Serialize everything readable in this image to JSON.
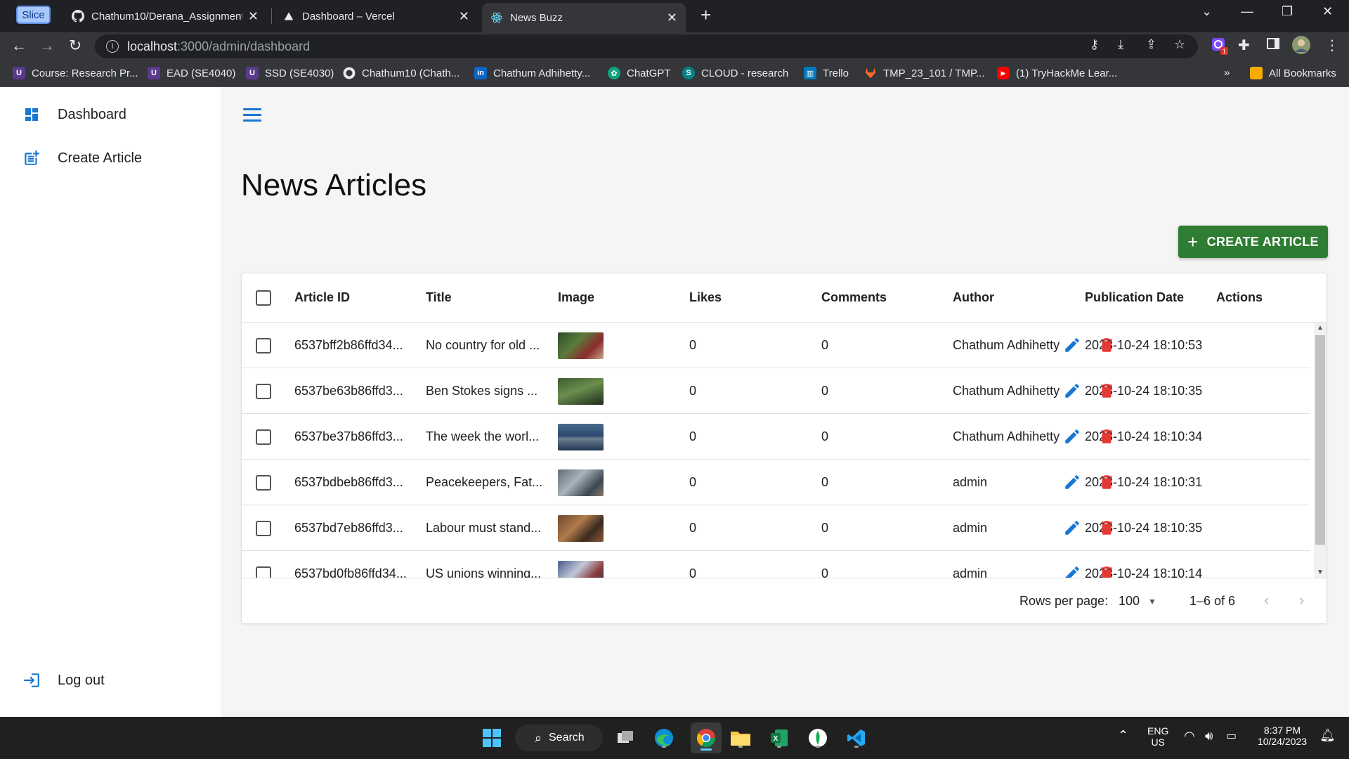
{
  "browser": {
    "slice_label": "Slice",
    "tabs": [
      {
        "title": "Chathum10/Derana_Assignment",
        "icon": "github-icon"
      },
      {
        "title": "Dashboard – Vercel",
        "icon": "vercel-icon"
      },
      {
        "title": "News Buzz",
        "icon": "react-icon",
        "active": true
      }
    ],
    "url_host": "localhost",
    "url_path": ":3000/admin/dashboard",
    "bookmarks": [
      {
        "label": "Course: Research Pr...",
        "icon": "university-icon"
      },
      {
        "label": "EAD (SE4040)",
        "icon": "university-icon"
      },
      {
        "label": "SSD (SE4030)",
        "icon": "university-icon"
      },
      {
        "label": "Chathum10 (Chath...",
        "icon": "github-icon"
      },
      {
        "label": "Chathum Adhihetty...",
        "icon": "linkedin-icon"
      },
      {
        "label": "ChatGPT",
        "icon": "chatgpt-icon"
      },
      {
        "label": "CLOUD - research",
        "icon": "sharepoint-icon"
      },
      {
        "label": "Trello",
        "icon": "trello-icon"
      },
      {
        "label": "TMP_23_101 / TMP...",
        "icon": "gitlab-icon"
      },
      {
        "label": "(1) TryHackMe Lear...",
        "icon": "youtube-icon"
      }
    ],
    "bookmarks_overflow": "»",
    "all_bookmarks": "All Bookmarks"
  },
  "sidebar": {
    "items": [
      {
        "label": "Dashboard",
        "icon": "dashboard-icon"
      },
      {
        "label": "Create Article",
        "icon": "post-add-icon"
      }
    ],
    "logout_label": "Log out"
  },
  "main": {
    "title": "News Articles",
    "create_button": "CREATE ARTICLE"
  },
  "table": {
    "columns": [
      "Article ID",
      "Title",
      "Image",
      "Likes",
      "Comments",
      "Author",
      "Publication Date",
      "Actions"
    ],
    "rows": [
      {
        "id": "6537bff2b86ffd34...",
        "title": "No country for old ...",
        "likes": "0",
        "comments": "0",
        "author": "Chathum Adhihetty",
        "date": "2023-10-24 18:10:53"
      },
      {
        "id": "6537be63b86ffd3...",
        "title": "Ben Stokes signs ...",
        "likes": "0",
        "comments": "0",
        "author": "Chathum Adhihetty",
        "date": "2023-10-24 18:10:35"
      },
      {
        "id": "6537be37b86ffd3...",
        "title": "The week the worl...",
        "likes": "0",
        "comments": "0",
        "author": "Chathum Adhihetty",
        "date": "2023-10-24 18:10:34"
      },
      {
        "id": "6537bdbeb86ffd3...",
        "title": "Peacekeepers, Fat...",
        "likes": "0",
        "comments": "0",
        "author": "admin",
        "date": "2023-10-24 18:10:31"
      },
      {
        "id": "6537bd7eb86ffd3...",
        "title": "Labour must stand...",
        "likes": "0",
        "comments": "0",
        "author": "admin",
        "date": "2023-10-24 18:10:35"
      },
      {
        "id": "6537bd0fb86ffd34...",
        "title": "US unions winning...",
        "likes": "0",
        "comments": "0",
        "author": "admin",
        "date": "2023-10-24 18:10:14"
      }
    ],
    "rows_per_page_label": "Rows per page:",
    "rows_per_page_value": "100",
    "pagination_text": "1–6 of 6"
  },
  "taskbar": {
    "search_label": "Search",
    "lang_line1": "ENG",
    "lang_line2": "US",
    "time": "8:37 PM",
    "date": "10/24/2023"
  },
  "colors": {
    "accent": "#1976d2",
    "create_button": "#2e7d32",
    "delete": "#e53935"
  }
}
